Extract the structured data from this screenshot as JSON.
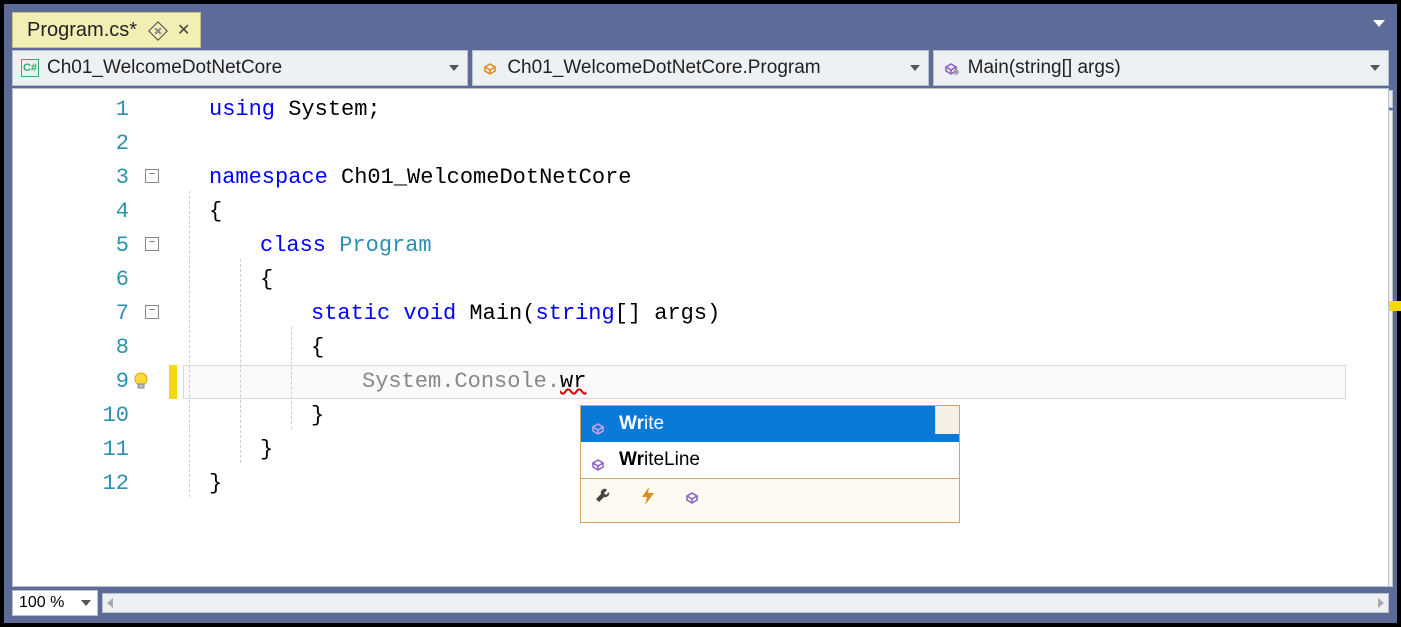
{
  "tab": {
    "title": "Program.cs*"
  },
  "nav": {
    "project": "Ch01_WelcomeDotNetCore",
    "class": "Ch01_WelcomeDotNetCore.Program",
    "method": "Main(string[] args)"
  },
  "zoom": "100 %",
  "code": {
    "lines": [
      {
        "n": 1
      },
      {
        "n": 2
      },
      {
        "n": 3
      },
      {
        "n": 4
      },
      {
        "n": 5
      },
      {
        "n": 6
      },
      {
        "n": 7
      },
      {
        "n": 8
      },
      {
        "n": 9
      },
      {
        "n": 10
      },
      {
        "n": 11
      },
      {
        "n": 12
      }
    ],
    "tokens": {
      "l1_kw": "using",
      "l1_sys": " System;",
      "l3_kw": "namespace",
      "l3_name": " Ch01_WelcomeDotNetCore",
      "l4_brace": "{",
      "l5_kw": "class",
      "l5_name": " Program",
      "l6_brace": "{",
      "l7_kw1": "static",
      "l7_kw2": " void",
      "l7_main": " Main(",
      "l7_kw3": "string",
      "l7_rest": "[] args)",
      "l8_brace": "{",
      "l9_sys": "System",
      "l9_dot1": ".",
      "l9_con": "Console",
      "l9_dot2": ".",
      "l9_wr": "wr",
      "l10_brace": "}",
      "l11_brace": "}",
      "l12_brace": "}"
    }
  },
  "intellisense": {
    "items": [
      {
        "prefix": "Wr",
        "rest": "ite",
        "selected": true
      },
      {
        "prefix": "Wr",
        "rest": "iteLine",
        "selected": false
      }
    ]
  },
  "colors": {
    "keyword": "#0000ff",
    "type": "#2b91af",
    "tab_bg": "#f3efb4",
    "intellisense_border": "#cba85e",
    "selection": "#0a7ad9"
  }
}
